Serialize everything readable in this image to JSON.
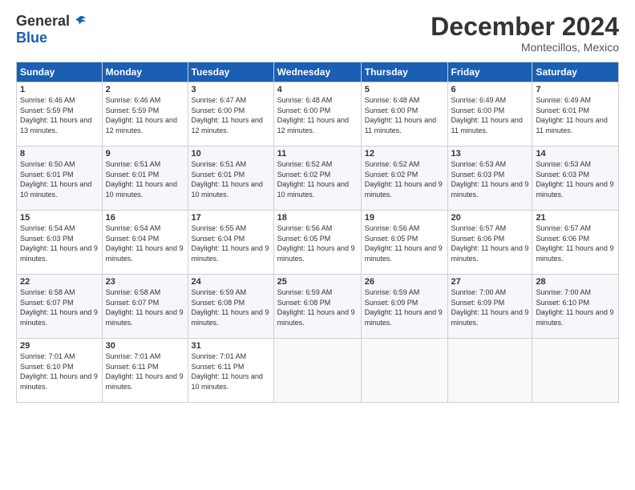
{
  "logo": {
    "general": "General",
    "blue": "Blue"
  },
  "title": "December 2024",
  "location": "Montecillos, Mexico",
  "days_header": [
    "Sunday",
    "Monday",
    "Tuesday",
    "Wednesday",
    "Thursday",
    "Friday",
    "Saturday"
  ],
  "weeks": [
    [
      {
        "day": "1",
        "sunrise": "6:46 AM",
        "sunset": "5:59 PM",
        "daylight": "11 hours and 13 minutes."
      },
      {
        "day": "2",
        "sunrise": "6:46 AM",
        "sunset": "5:59 PM",
        "daylight": "11 hours and 12 minutes."
      },
      {
        "day": "3",
        "sunrise": "6:47 AM",
        "sunset": "6:00 PM",
        "daylight": "11 hours and 12 minutes."
      },
      {
        "day": "4",
        "sunrise": "6:48 AM",
        "sunset": "6:00 PM",
        "daylight": "11 hours and 12 minutes."
      },
      {
        "day": "5",
        "sunrise": "6:48 AM",
        "sunset": "6:00 PM",
        "daylight": "11 hours and 11 minutes."
      },
      {
        "day": "6",
        "sunrise": "6:49 AM",
        "sunset": "6:00 PM",
        "daylight": "11 hours and 11 minutes."
      },
      {
        "day": "7",
        "sunrise": "6:49 AM",
        "sunset": "6:01 PM",
        "daylight": "11 hours and 11 minutes."
      }
    ],
    [
      {
        "day": "8",
        "sunrise": "6:50 AM",
        "sunset": "6:01 PM",
        "daylight": "11 hours and 10 minutes."
      },
      {
        "day": "9",
        "sunrise": "6:51 AM",
        "sunset": "6:01 PM",
        "daylight": "11 hours and 10 minutes."
      },
      {
        "day": "10",
        "sunrise": "6:51 AM",
        "sunset": "6:01 PM",
        "daylight": "11 hours and 10 minutes."
      },
      {
        "day": "11",
        "sunrise": "6:52 AM",
        "sunset": "6:02 PM",
        "daylight": "11 hours and 10 minutes."
      },
      {
        "day": "12",
        "sunrise": "6:52 AM",
        "sunset": "6:02 PM",
        "daylight": "11 hours and 9 minutes."
      },
      {
        "day": "13",
        "sunrise": "6:53 AM",
        "sunset": "6:03 PM",
        "daylight": "11 hours and 9 minutes."
      },
      {
        "day": "14",
        "sunrise": "6:53 AM",
        "sunset": "6:03 PM",
        "daylight": "11 hours and 9 minutes."
      }
    ],
    [
      {
        "day": "15",
        "sunrise": "6:54 AM",
        "sunset": "6:03 PM",
        "daylight": "11 hours and 9 minutes."
      },
      {
        "day": "16",
        "sunrise": "6:54 AM",
        "sunset": "6:04 PM",
        "daylight": "11 hours and 9 minutes."
      },
      {
        "day": "17",
        "sunrise": "6:55 AM",
        "sunset": "6:04 PM",
        "daylight": "11 hours and 9 minutes."
      },
      {
        "day": "18",
        "sunrise": "6:56 AM",
        "sunset": "6:05 PM",
        "daylight": "11 hours and 9 minutes."
      },
      {
        "day": "19",
        "sunrise": "6:56 AM",
        "sunset": "6:05 PM",
        "daylight": "11 hours and 9 minutes."
      },
      {
        "day": "20",
        "sunrise": "6:57 AM",
        "sunset": "6:06 PM",
        "daylight": "11 hours and 9 minutes."
      },
      {
        "day": "21",
        "sunrise": "6:57 AM",
        "sunset": "6:06 PM",
        "daylight": "11 hours and 9 minutes."
      }
    ],
    [
      {
        "day": "22",
        "sunrise": "6:58 AM",
        "sunset": "6:07 PM",
        "daylight": "11 hours and 9 minutes."
      },
      {
        "day": "23",
        "sunrise": "6:58 AM",
        "sunset": "6:07 PM",
        "daylight": "11 hours and 9 minutes."
      },
      {
        "day": "24",
        "sunrise": "6:59 AM",
        "sunset": "6:08 PM",
        "daylight": "11 hours and 9 minutes."
      },
      {
        "day": "25",
        "sunrise": "6:59 AM",
        "sunset": "6:08 PM",
        "daylight": "11 hours and 9 minutes."
      },
      {
        "day": "26",
        "sunrise": "6:59 AM",
        "sunset": "6:09 PM",
        "daylight": "11 hours and 9 minutes."
      },
      {
        "day": "27",
        "sunrise": "7:00 AM",
        "sunset": "6:09 PM",
        "daylight": "11 hours and 9 minutes."
      },
      {
        "day": "28",
        "sunrise": "7:00 AM",
        "sunset": "6:10 PM",
        "daylight": "11 hours and 9 minutes."
      }
    ],
    [
      {
        "day": "29",
        "sunrise": "7:01 AM",
        "sunset": "6:10 PM",
        "daylight": "11 hours and 9 minutes."
      },
      {
        "day": "30",
        "sunrise": "7:01 AM",
        "sunset": "6:11 PM",
        "daylight": "11 hours and 9 minutes."
      },
      {
        "day": "31",
        "sunrise": "7:01 AM",
        "sunset": "6:11 PM",
        "daylight": "11 hours and 10 minutes."
      },
      null,
      null,
      null,
      null
    ]
  ]
}
